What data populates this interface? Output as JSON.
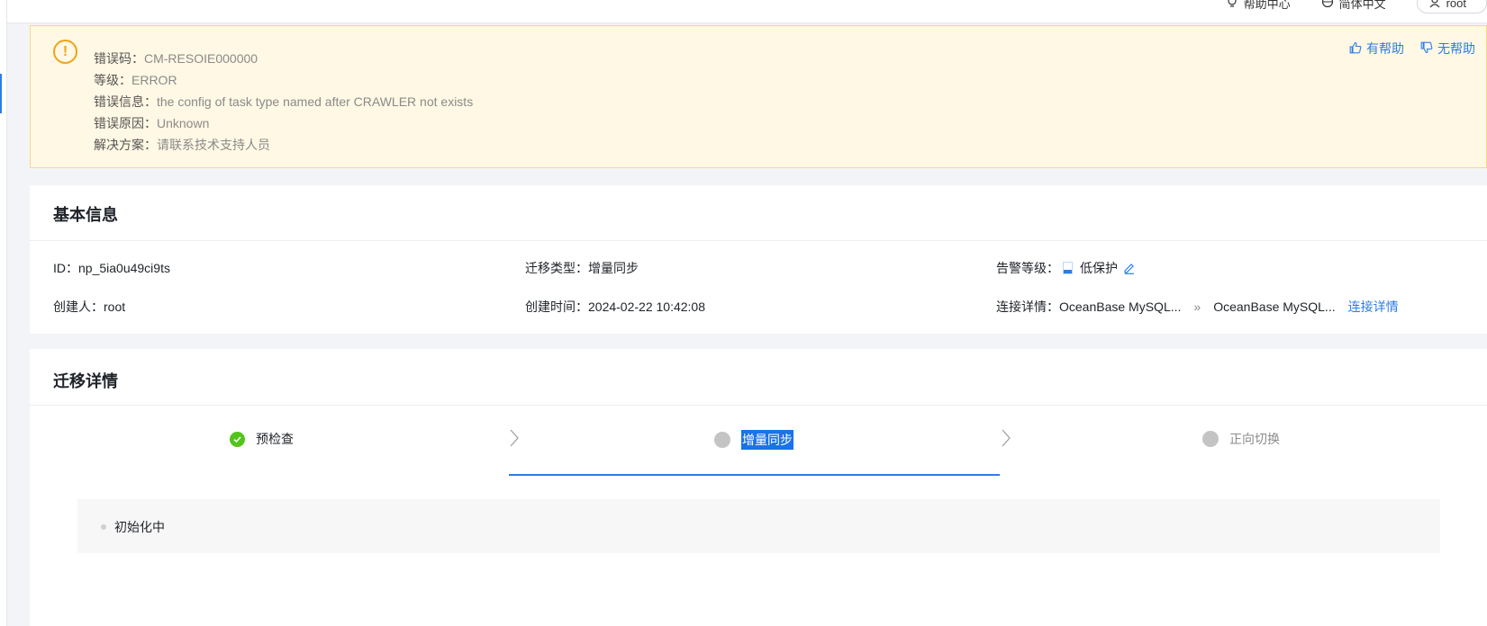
{
  "topbar": {
    "help_center": "帮助中心",
    "language": "简体中文",
    "user": "root"
  },
  "error": {
    "code_label": "错误码：",
    "code_value": "CM-RESOIE000000",
    "level_label": "等级：",
    "level_value": "ERROR",
    "message_label": "错误信息：",
    "message_value": "the config of task type named after CRAWLER not exists",
    "cause_label": "错误原因：",
    "cause_value": "Unknown",
    "solution_label": "解决方案：",
    "solution_value": "请联系技术支持人员",
    "helpful_label": "有帮助",
    "not_helpful_label": "无帮助"
  },
  "basic_info": {
    "title": "基本信息",
    "id_label": "ID：",
    "id_value": "np_5ia0u49ci9ts",
    "type_label": "迁移类型：",
    "type_value": "增量同步",
    "alert_label": "告警等级：",
    "alert_value": "低保护",
    "creator_label": "创建人：",
    "creator_value": "root",
    "created_label": "创建时间：",
    "created_value": "2024-02-22 10:42:08",
    "conn_label": "连接详情：",
    "conn_source": "OceanBase MySQL...",
    "conn_arrow": "»",
    "conn_target": "OceanBase MySQL...",
    "conn_link": "连接详情"
  },
  "migration": {
    "title": "迁移详情",
    "steps": [
      {
        "label": "预检查",
        "status": "done"
      },
      {
        "label": "增量同步",
        "status": "active"
      },
      {
        "label": "正向切换",
        "status": "pending"
      }
    ],
    "status_text": "初始化中"
  },
  "colors": {
    "accent": "#2b7de9",
    "warning": "#f1a215",
    "success": "#52c41a",
    "error_bg": "#fff8e4"
  }
}
